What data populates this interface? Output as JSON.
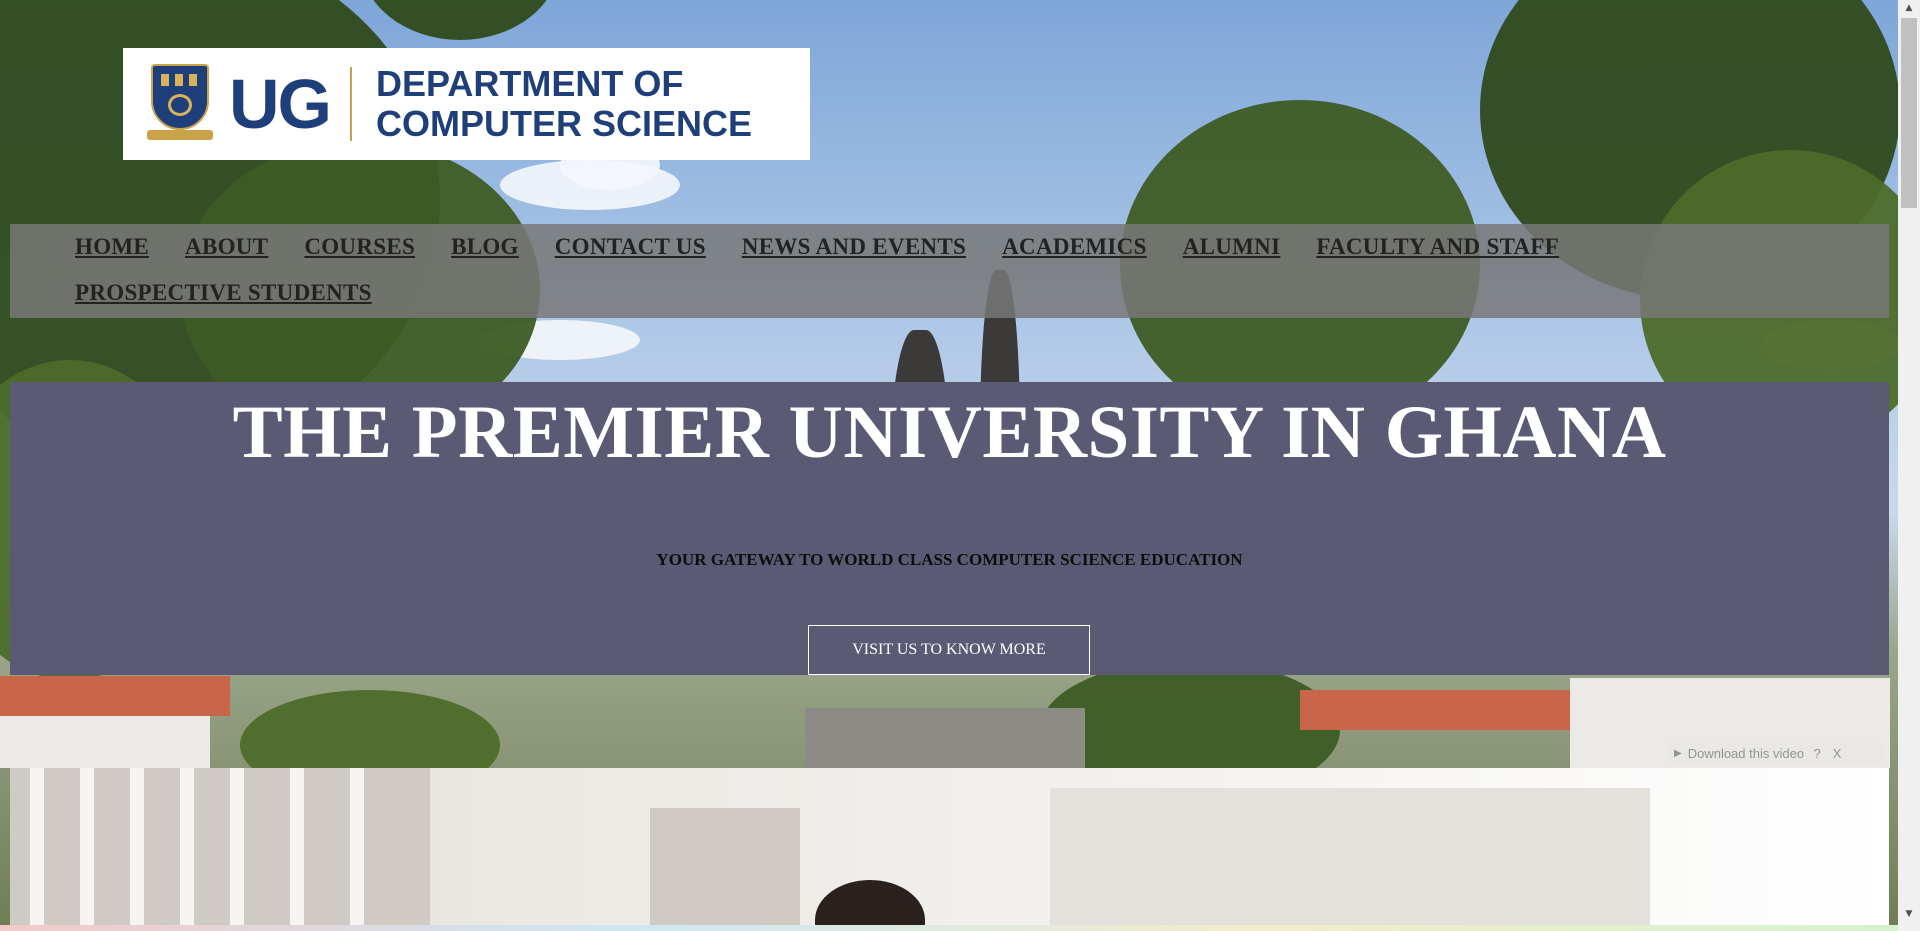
{
  "logo": {
    "abbr": "UG",
    "dept_line1": "DEPARTMENT OF",
    "dept_line2": "COMPUTER SCIENCE"
  },
  "nav": {
    "items": [
      {
        "label": "HOME"
      },
      {
        "label": "ABOUT"
      },
      {
        "label": "COURSES"
      },
      {
        "label": "BLOG"
      },
      {
        "label": "CONTACT US"
      },
      {
        "label": "NEWS AND EVENTS"
      },
      {
        "label": "ACADEMICS"
      },
      {
        "label": "ALUMNI"
      },
      {
        "label": "FACULTY AND STAFF"
      },
      {
        "label": "PROSPECTIVE STUDENTS"
      }
    ]
  },
  "hero": {
    "title": "THE PREMIER UNIVERSITY IN GHANA",
    "subtitle": "YOUR GATEWAY TO WORLD CLASS COMPUTER SCIENCE EDUCATION",
    "button_label": "VISIT US TO KNOW MORE"
  },
  "video_overlay": {
    "download_label": "Download this video",
    "help_label": "?",
    "close_label": "X"
  },
  "colors": {
    "brand_blue": "#1f3f7a",
    "brand_gold": "#c9a24a",
    "hero_bg": "#5b5a75",
    "nav_bg": "#787878"
  }
}
